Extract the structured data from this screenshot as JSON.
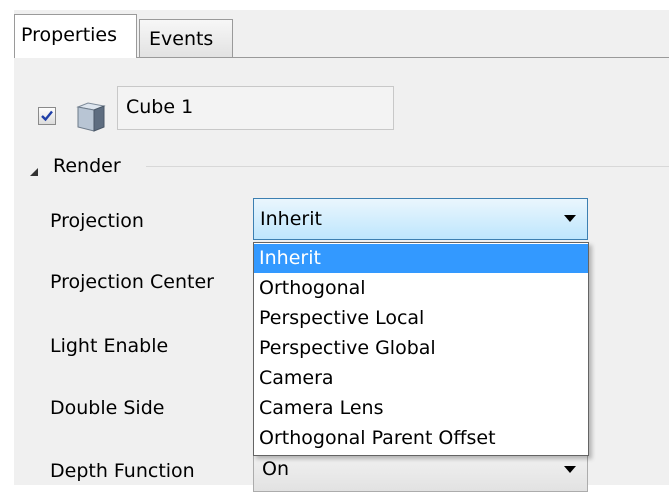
{
  "tabs": [
    {
      "label": "Properties",
      "active": true
    },
    {
      "label": "Events",
      "active": false
    }
  ],
  "object": {
    "enabled": true,
    "name": "Cube 1",
    "icon": "cube-icon"
  },
  "group": {
    "title": "Render",
    "expanded": true
  },
  "properties": [
    {
      "label": "Projection"
    },
    {
      "label": "Projection Center"
    },
    {
      "label": "Light Enable"
    },
    {
      "label": "Double Side"
    },
    {
      "label": "Depth Function"
    }
  ],
  "projection_select": {
    "value": "Inherit",
    "options": [
      "Inherit",
      "Orthogonal",
      "Perspective Local",
      "Perspective Global",
      "Camera",
      "Camera Lens",
      "Orthogonal Parent Offset"
    ],
    "selected_index": 0
  },
  "depth_function_select": {
    "value": "On"
  },
  "colors": {
    "highlight": "#3399ff",
    "select_border": "#3c7fb1",
    "panel_bg": "#f0f0f0"
  }
}
